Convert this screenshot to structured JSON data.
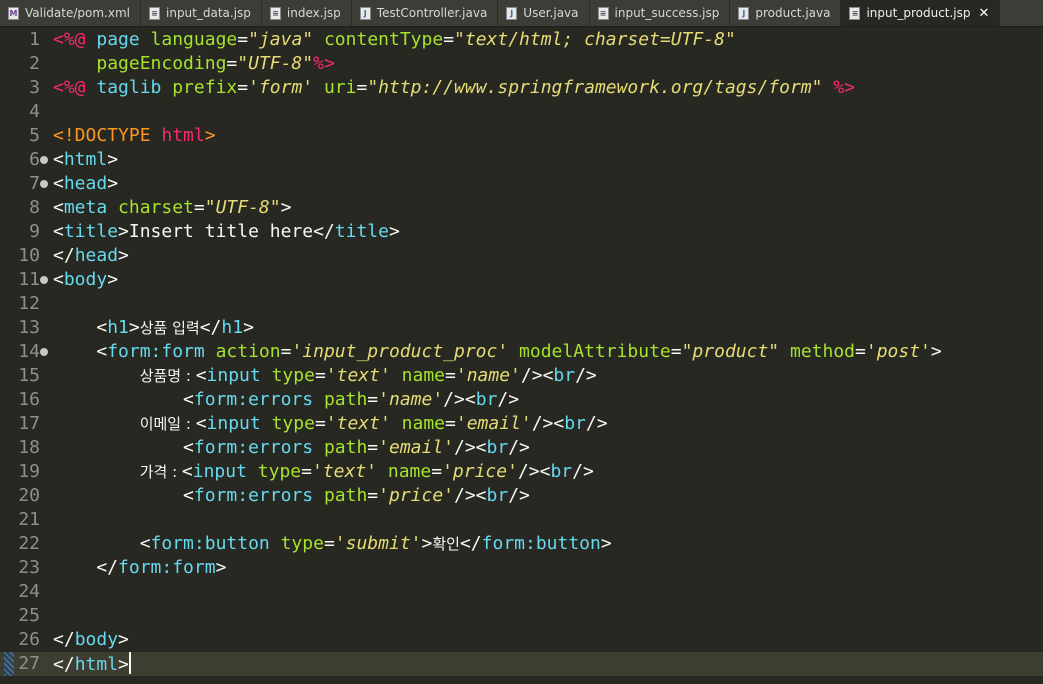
{
  "tabs": [
    {
      "label": "Validate/pom.xml",
      "icon": "xml-file-icon",
      "type": "xml"
    },
    {
      "label": "input_data.jsp",
      "icon": "jsp-file-icon",
      "type": "jsp"
    },
    {
      "label": "index.jsp",
      "icon": "jsp-file-icon",
      "type": "jsp"
    },
    {
      "label": "TestController.java",
      "icon": "java-file-icon",
      "type": "java"
    },
    {
      "label": "User.java",
      "icon": "java-file-icon",
      "type": "java"
    },
    {
      "label": "input_success.jsp",
      "icon": "jsp-file-icon",
      "type": "jsp"
    },
    {
      "label": "product.java",
      "icon": "java-file-icon",
      "type": "java"
    },
    {
      "label": "input_product.jsp",
      "icon": "jsp-file-icon",
      "type": "jsp",
      "active": true
    }
  ],
  "editor": {
    "current_line": 27,
    "folded_lines": [
      6,
      7,
      11,
      14
    ],
    "lines": [
      {
        "n": 1,
        "tokens": [
          [
            "p",
            "<%@ "
          ],
          [
            "k",
            "page "
          ],
          [
            "a",
            "language"
          ],
          [
            "b",
            "="
          ],
          [
            "s",
            "\"java\""
          ],
          [
            "b",
            " "
          ],
          [
            "a",
            "contentType"
          ],
          [
            "b",
            "="
          ],
          [
            "s",
            "\"text/html; charset=UTF-8\""
          ]
        ]
      },
      {
        "n": 2,
        "tokens": [
          [
            "b",
            "    "
          ],
          [
            "a",
            "pageEncoding"
          ],
          [
            "b",
            "="
          ],
          [
            "s",
            "\"UTF-8\""
          ],
          [
            "p",
            "%>"
          ]
        ]
      },
      {
        "n": 3,
        "tokens": [
          [
            "p",
            "<%@ "
          ],
          [
            "k",
            "taglib "
          ],
          [
            "a",
            "prefix"
          ],
          [
            "b",
            "="
          ],
          [
            "s",
            "'form'"
          ],
          [
            "b",
            " "
          ],
          [
            "a",
            "uri"
          ],
          [
            "b",
            "="
          ],
          [
            "s",
            "\"http://www.springframework.org/tags/form\""
          ],
          [
            "b",
            " "
          ],
          [
            "p",
            "%>"
          ]
        ]
      },
      {
        "n": 4,
        "tokens": []
      },
      {
        "n": 5,
        "tokens": [
          [
            "d",
            "<!DOCTYPE "
          ],
          [
            "p",
            "html"
          ],
          [
            "d",
            ">"
          ]
        ]
      },
      {
        "n": 6,
        "tokens": [
          [
            "b",
            "<"
          ],
          [
            "k",
            "html"
          ],
          [
            "b",
            ">"
          ]
        ]
      },
      {
        "n": 7,
        "tokens": [
          [
            "b",
            "<"
          ],
          [
            "k",
            "head"
          ],
          [
            "b",
            ">"
          ]
        ]
      },
      {
        "n": 8,
        "tokens": [
          [
            "b",
            "<"
          ],
          [
            "k",
            "meta "
          ],
          [
            "a",
            "charset"
          ],
          [
            "b",
            "="
          ],
          [
            "s",
            "\"UTF-8\""
          ],
          [
            "b",
            ">"
          ]
        ]
      },
      {
        "n": 9,
        "tokens": [
          [
            "b",
            "<"
          ],
          [
            "k",
            "title"
          ],
          [
            "b",
            ">Insert title here</"
          ],
          [
            "k",
            "title"
          ],
          [
            "b",
            ">"
          ]
        ]
      },
      {
        "n": 10,
        "tokens": [
          [
            "b",
            "</"
          ],
          [
            "k",
            "head"
          ],
          [
            "b",
            ">"
          ]
        ]
      },
      {
        "n": 11,
        "tokens": [
          [
            "b",
            "<"
          ],
          [
            "k",
            "body"
          ],
          [
            "b",
            ">"
          ]
        ]
      },
      {
        "n": 12,
        "tokens": []
      },
      {
        "n": 13,
        "tokens": [
          [
            "b",
            "    <"
          ],
          [
            "k",
            "h1"
          ],
          [
            "b",
            ">"
          ],
          [
            "kr",
            "상품 입력"
          ],
          [
            "b",
            "</"
          ],
          [
            "k",
            "h1"
          ],
          [
            "b",
            ">"
          ]
        ]
      },
      {
        "n": 14,
        "tokens": [
          [
            "b",
            "    <"
          ],
          [
            "k",
            "form:form "
          ],
          [
            "a",
            "action"
          ],
          [
            "b",
            "="
          ],
          [
            "s",
            "'input_product_proc'"
          ],
          [
            "b",
            " "
          ],
          [
            "a",
            "modelAttribute"
          ],
          [
            "b",
            "="
          ],
          [
            "s",
            "\"product\""
          ],
          [
            "b",
            " "
          ],
          [
            "a",
            "method"
          ],
          [
            "b",
            "="
          ],
          [
            "s",
            "'post'"
          ],
          [
            "b",
            ">"
          ]
        ]
      },
      {
        "n": 15,
        "tokens": [
          [
            "b",
            "        "
          ],
          [
            "kr",
            "상품명 : "
          ],
          [
            "b",
            "<"
          ],
          [
            "k",
            "input "
          ],
          [
            "a",
            "type"
          ],
          [
            "b",
            "="
          ],
          [
            "s",
            "'text'"
          ],
          [
            "b",
            " "
          ],
          [
            "a",
            "name"
          ],
          [
            "b",
            "="
          ],
          [
            "s",
            "'name'"
          ],
          [
            "b",
            "/><"
          ],
          [
            "k",
            "br"
          ],
          [
            "b",
            "/>"
          ]
        ]
      },
      {
        "n": 16,
        "tokens": [
          [
            "b",
            "            <"
          ],
          [
            "k",
            "form:errors "
          ],
          [
            "a",
            "path"
          ],
          [
            "b",
            "="
          ],
          [
            "s",
            "'name'"
          ],
          [
            "b",
            "/><"
          ],
          [
            "k",
            "br"
          ],
          [
            "b",
            "/>"
          ]
        ]
      },
      {
        "n": 17,
        "tokens": [
          [
            "b",
            "        "
          ],
          [
            "kr",
            "이메일 : "
          ],
          [
            "b",
            "<"
          ],
          [
            "k",
            "input "
          ],
          [
            "a",
            "type"
          ],
          [
            "b",
            "="
          ],
          [
            "s",
            "'text'"
          ],
          [
            "b",
            " "
          ],
          [
            "a",
            "name"
          ],
          [
            "b",
            "="
          ],
          [
            "s",
            "'email'"
          ],
          [
            "b",
            "/><"
          ],
          [
            "k",
            "br"
          ],
          [
            "b",
            "/>"
          ]
        ]
      },
      {
        "n": 18,
        "tokens": [
          [
            "b",
            "            <"
          ],
          [
            "k",
            "form:errors "
          ],
          [
            "a",
            "path"
          ],
          [
            "b",
            "="
          ],
          [
            "s",
            "'email'"
          ],
          [
            "b",
            "/><"
          ],
          [
            "k",
            "br"
          ],
          [
            "b",
            "/>"
          ]
        ]
      },
      {
        "n": 19,
        "tokens": [
          [
            "b",
            "        "
          ],
          [
            "kr",
            "가격 : "
          ],
          [
            "b",
            "<"
          ],
          [
            "k",
            "input "
          ],
          [
            "a",
            "type"
          ],
          [
            "b",
            "="
          ],
          [
            "s",
            "'text'"
          ],
          [
            "b",
            " "
          ],
          [
            "a",
            "name"
          ],
          [
            "b",
            "="
          ],
          [
            "s",
            "'price'"
          ],
          [
            "b",
            "/><"
          ],
          [
            "k",
            "br"
          ],
          [
            "b",
            "/>"
          ]
        ]
      },
      {
        "n": 20,
        "tokens": [
          [
            "b",
            "            <"
          ],
          [
            "k",
            "form:errors "
          ],
          [
            "a",
            "path"
          ],
          [
            "b",
            "="
          ],
          [
            "s",
            "'price'"
          ],
          [
            "b",
            "/><"
          ],
          [
            "k",
            "br"
          ],
          [
            "b",
            "/>"
          ]
        ]
      },
      {
        "n": 21,
        "tokens": []
      },
      {
        "n": 22,
        "tokens": [
          [
            "b",
            "        <"
          ],
          [
            "k",
            "form:button "
          ],
          [
            "a",
            "type"
          ],
          [
            "b",
            "="
          ],
          [
            "s",
            "'submit'"
          ],
          [
            "b",
            ">"
          ],
          [
            "kr",
            "확인"
          ],
          [
            "b",
            "</"
          ],
          [
            "k",
            "form:button"
          ],
          [
            "b",
            ">"
          ]
        ]
      },
      {
        "n": 23,
        "tokens": [
          [
            "b",
            "    </"
          ],
          [
            "k",
            "form:form"
          ],
          [
            "b",
            ">"
          ]
        ]
      },
      {
        "n": 24,
        "tokens": []
      },
      {
        "n": 25,
        "tokens": []
      },
      {
        "n": 26,
        "tokens": [
          [
            "b",
            "</"
          ],
          [
            "k",
            "body"
          ],
          [
            "b",
            ">"
          ]
        ]
      },
      {
        "n": 27,
        "tokens": [
          [
            "b",
            "</"
          ],
          [
            "k",
            "html"
          ],
          [
            "b",
            ">"
          ]
        ]
      }
    ]
  },
  "colors": {
    "background": "#272822",
    "keyword": "#66d9ef",
    "attribute": "#a6e22e",
    "string": "#e6db74",
    "directive": "#f92672"
  }
}
